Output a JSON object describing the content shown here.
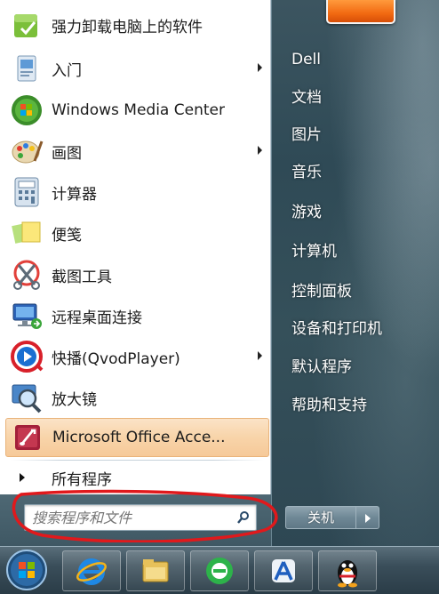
{
  "programs": [
    {
      "label": "强力卸载电脑上的软件",
      "icon": "uninstaller-icon",
      "arrow": false
    },
    {
      "label": "入门",
      "icon": "getting-started-icon",
      "arrow": true
    },
    {
      "label": "Windows Media Center",
      "icon": "media-center-icon",
      "arrow": false
    },
    {
      "label": "画图",
      "icon": "paint-icon",
      "arrow": true
    },
    {
      "label": "计算器",
      "icon": "calculator-icon",
      "arrow": false
    },
    {
      "label": "便笺",
      "icon": "sticky-notes-icon",
      "arrow": false
    },
    {
      "label": "截图工具",
      "icon": "snipping-tool-icon",
      "arrow": false
    },
    {
      "label": "远程桌面连接",
      "icon": "remote-desktop-icon",
      "arrow": false
    },
    {
      "label": "快播(QvodPlayer)",
      "icon": "qvod-player-icon",
      "arrow": true
    },
    {
      "label": "放大镜",
      "icon": "magnifier-icon",
      "arrow": false
    },
    {
      "label": "Microsoft Office Acce...",
      "icon": "office-access-icon",
      "arrow": false
    }
  ],
  "all_programs_label": "所有程序",
  "search": {
    "placeholder": "搜索程序和文件"
  },
  "right_items": [
    "Dell",
    "文档",
    "图片",
    "音乐",
    "游戏",
    "计算机",
    "控制面板",
    "设备和打印机",
    "默认程序",
    "帮助和支持"
  ],
  "shutdown_label": "关机",
  "taskbar_icons": [
    "internet-explorer-icon",
    "file-explorer-icon",
    "browser-360-icon",
    "app-blue-icon",
    "qq-penguin-icon"
  ],
  "colors": {
    "highlight": "#f8d4a9",
    "annotation_red": "#e0191c",
    "glass": "#35505a"
  }
}
